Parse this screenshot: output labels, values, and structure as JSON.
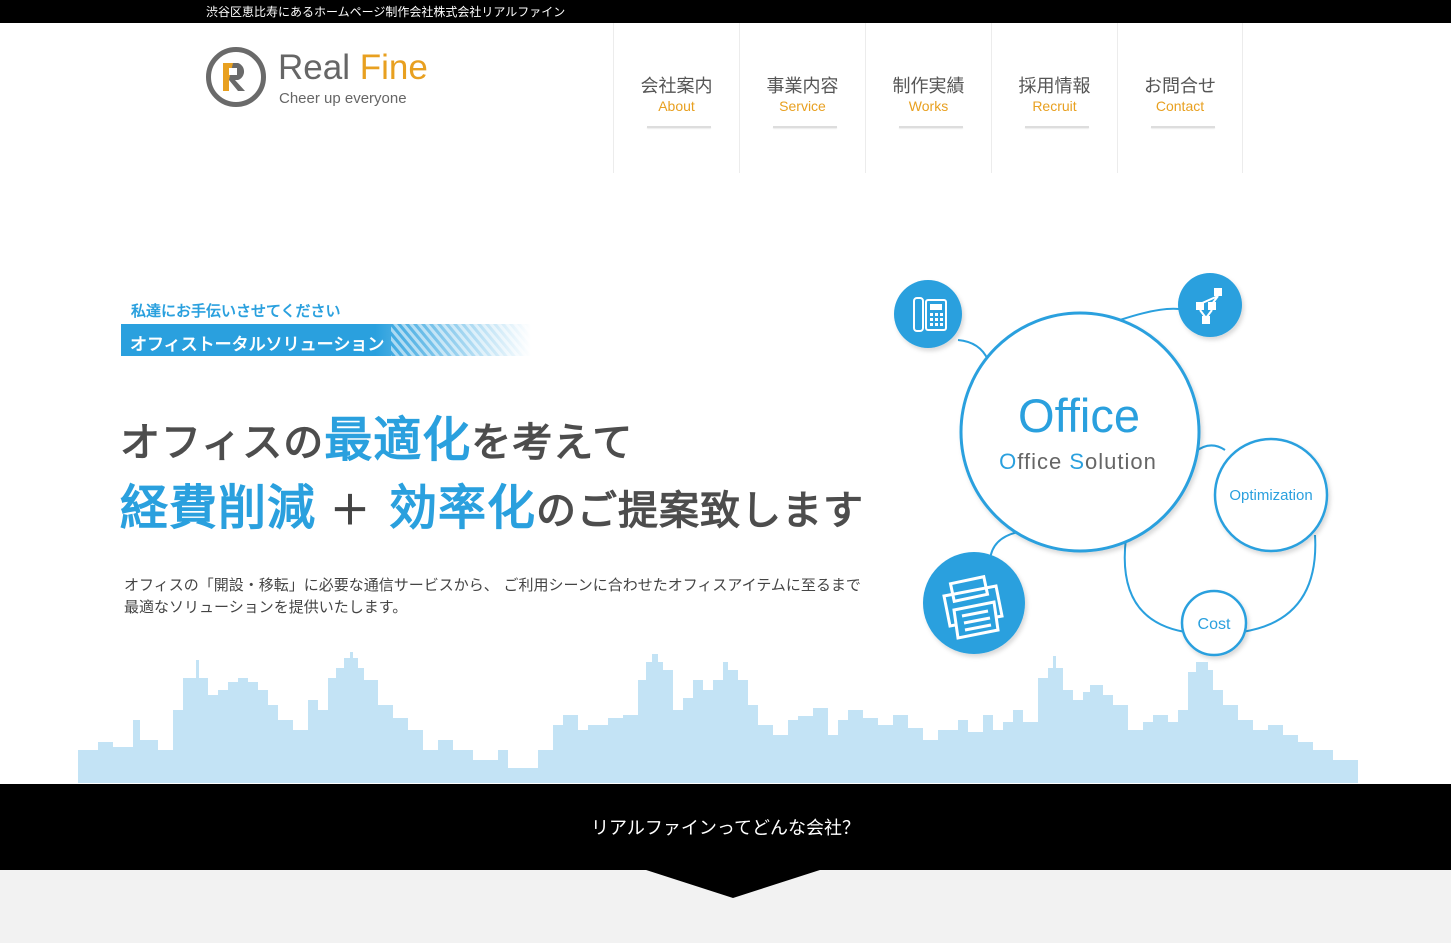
{
  "topbar": {
    "text": "渋谷区恵比寿にあるホームページ制作会社株式会社リアルファイン"
  },
  "logo": {
    "name_a": "Real ",
    "name_b": "Fine",
    "tagline": "Cheer up everyone",
    "brand_orange": "#e8a020",
    "brand_gray": "#6a6a6a"
  },
  "nav": [
    {
      "ja": "会社案内",
      "en": "About"
    },
    {
      "ja": "事業内容",
      "en": "Service"
    },
    {
      "ja": "制作実績",
      "en": "Works"
    },
    {
      "ja": "採用情報",
      "en": "Recruit"
    },
    {
      "ja": "お問合せ",
      "en": "Contact"
    }
  ],
  "hero": {
    "sub_lead": "私達にお手伝いさせてください",
    "ribbon": "オフィストータルソリューション",
    "h1_a": "オフィスの",
    "h1_b": "最適化",
    "h1_c": "を考えて",
    "h2_a": "経費削減",
    "h2_plus": "＋",
    "h2_b": "効率化",
    "h2_c": "のご提案致します",
    "desc_1": "オフィスの「開設・移転」に必要な通信サービスから、 ご利用シーンに合わせたオフィスアイテムに至るまで",
    "desc_2": "最適なソリューションを提供いたします。",
    "accent": "#2aa0de"
  },
  "diagram": {
    "main": "Office",
    "sub_a": "O",
    "sub_b": "ffice ",
    "sub_c": "S",
    "sub_d": "olution",
    "optimization": "Optimization",
    "cost": "Cost",
    "icons": [
      "phone-icon",
      "network-icon",
      "fax-icon"
    ]
  },
  "band": {
    "text": "リアルファインってどんな会社？"
  }
}
